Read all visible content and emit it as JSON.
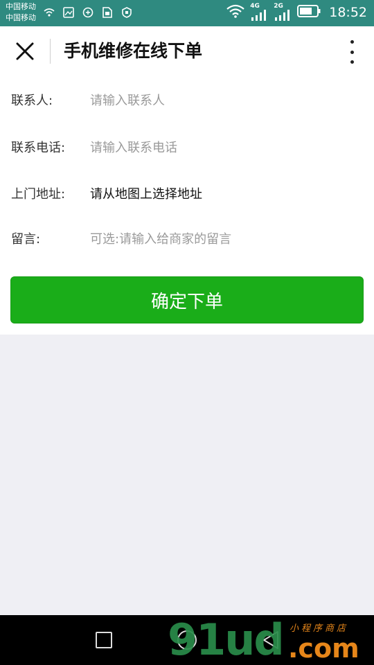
{
  "status_bar": {
    "carrier_1": "中国移动",
    "carrier_2": "中国移动",
    "network_1": "4G",
    "network_2": "2G",
    "time": "18:52",
    "icons": [
      "wifi-calling-icon",
      "image-icon",
      "vpn-icon",
      "sim-icon",
      "shield-icon",
      "wifi-icon",
      "signal-icon",
      "battery-icon"
    ]
  },
  "header": {
    "title": "手机维修在线下单",
    "close_icon": "close-icon",
    "more_icon": "more-vertical-icon"
  },
  "form": {
    "fields": [
      {
        "label": "联系人:",
        "placeholder": "请输入联系人"
      },
      {
        "label": "联系电话:",
        "placeholder": "请输入联系电话"
      },
      {
        "label": "上门地址:",
        "value": "请从地图上选择地址"
      },
      {
        "label": "留言:",
        "placeholder": "可选:请输入给商家的留言"
      }
    ],
    "submit_label": "确定下单"
  },
  "watermark": {
    "main": "91ud",
    "domain": ".com",
    "sub": "小程序商店"
  },
  "colors": {
    "status_bar": "#2f8a80",
    "accent": "#1aad19",
    "page_bg": "#efeff4"
  }
}
